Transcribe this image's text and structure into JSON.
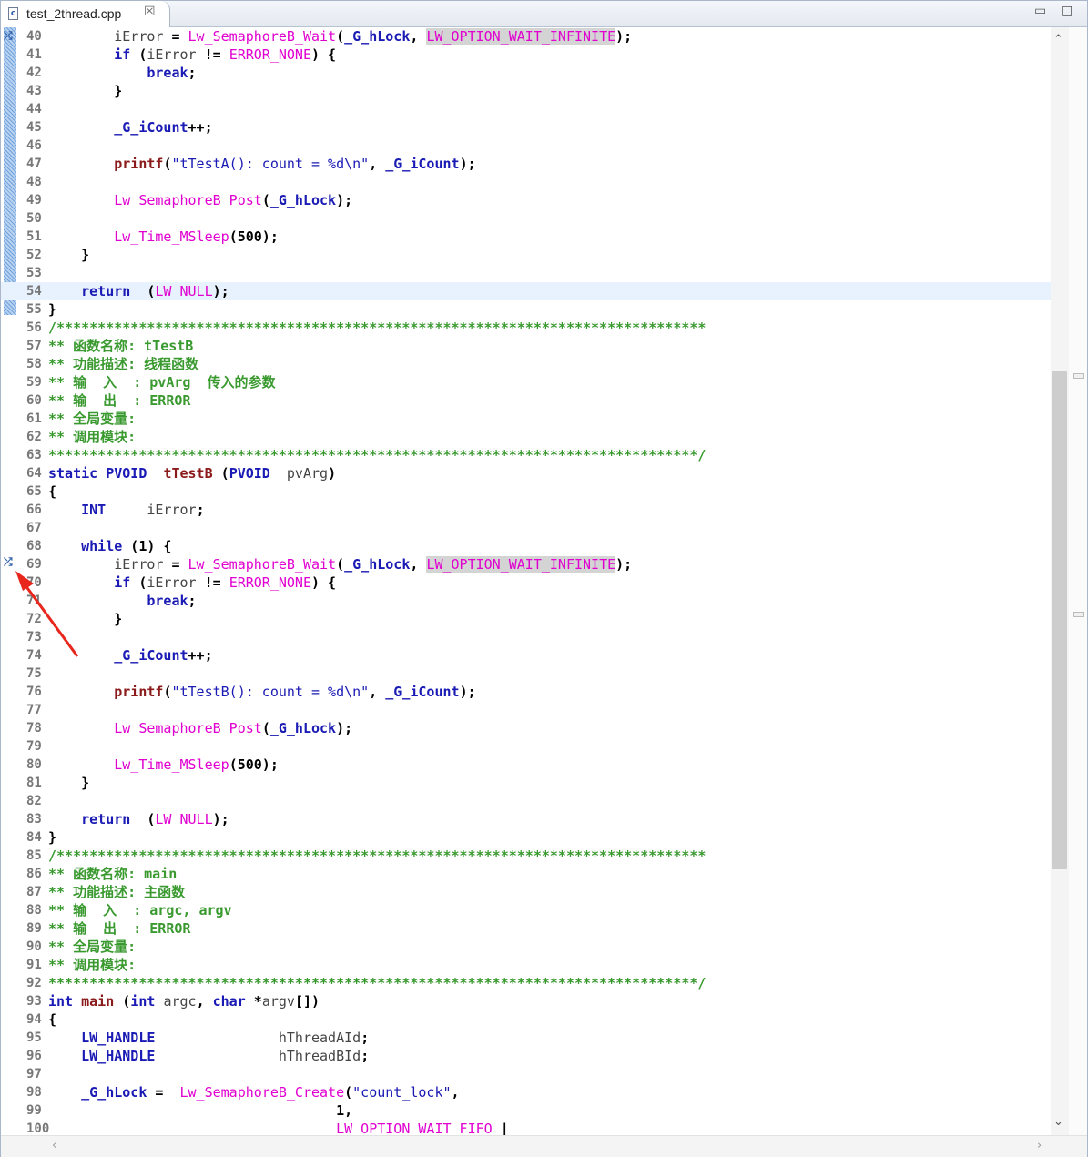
{
  "tab": {
    "file_icon": "c",
    "title": "test_2thread.cpp",
    "close": "☒"
  },
  "window": {
    "minimize": "▭",
    "maximize": "□"
  },
  "scroll": {
    "up": "⌃",
    "down": "⌄",
    "left": "‹",
    "right": "›"
  },
  "lines": [
    {
      "n": "40",
      "c": "        <span class='var'>iError</span> = <span class='fn'>Lw_SemaphoreB_Wait</span>(<span class='gvar'>_G_hLock</span>, <span class='mac hl'>LW_OPTION_WAIT_INFINITE</span>);"
    },
    {
      "n": "41",
      "c": "        <span class='kb'>if</span> (<span class='var'>iError</span> != <span class='mac'>ERROR_NONE</span>) {"
    },
    {
      "n": "42",
      "c": "            <span class='kb'>break</span>;"
    },
    {
      "n": "43",
      "c": "        }"
    },
    {
      "n": "44",
      "c": ""
    },
    {
      "n": "45",
      "c": "        <span class='gvar'>_G_iCount</span>++;"
    },
    {
      "n": "46",
      "c": ""
    },
    {
      "n": "47",
      "c": "        <span class='fnb'>printf</span>(<span class='str'>\"tTestA(): count = %d\\n\"</span>, <span class='gvar'>_G_iCount</span>);"
    },
    {
      "n": "48",
      "c": ""
    },
    {
      "n": "49",
      "c": "        <span class='fn'>Lw_SemaphoreB_Post</span>(<span class='gvar'>_G_hLock</span>);"
    },
    {
      "n": "50",
      "c": ""
    },
    {
      "n": "51",
      "c": "        <span class='fn'>Lw_Time_MSleep</span>(500);"
    },
    {
      "n": "52",
      "c": "    }"
    },
    {
      "n": "53",
      "c": ""
    },
    {
      "n": "54",
      "c": "    <span class='kb'>return</span>  (<span class='mac'>LW_NULL</span>);",
      "current": true
    },
    {
      "n": "55",
      "c": "}"
    },
    {
      "n": "56",
      "c": "<span class='cm'>/*******************************************************************************</span>"
    },
    {
      "n": "57",
      "c": "<span class='cm'>** 函数名称: tTestB</span>"
    },
    {
      "n": "58",
      "c": "<span class='cm'>** 功能描述: 线程函数</span>"
    },
    {
      "n": "59",
      "c": "<span class='cm'>** 输  入  : pvArg  传入的参数</span>"
    },
    {
      "n": "60",
      "c": "<span class='cm'>** 输  出  : ERROR</span>"
    },
    {
      "n": "61",
      "c": "<span class='cm'>** 全局变量:</span>"
    },
    {
      "n": "62",
      "c": "<span class='cm'>** 调用模块:</span>"
    },
    {
      "n": "63",
      "c": "<span class='cm'>*******************************************************************************/</span>"
    },
    {
      "n": "64",
      "c": "<span class='kb'>static</span> <span class='ty'>PVOID</span>  <span class='fnb'>tTestB</span> (<span class='ty'>PVOID</span>  <span class='var'>pvArg</span>)"
    },
    {
      "n": "65",
      "c": "{"
    },
    {
      "n": "66",
      "c": "    <span class='ty'>INT</span>     <span class='var'>iError</span>;"
    },
    {
      "n": "67",
      "c": ""
    },
    {
      "n": "68",
      "c": "    <span class='kb'>while</span> (1) {"
    },
    {
      "n": "69",
      "c": "        <span class='var'>iError</span> = <span class='fn'>Lw_SemaphoreB_Wait</span>(<span class='gvar'>_G_hLock</span>, <span class='mac hl'>LW_OPTION_WAIT_INFINITE</span>);"
    },
    {
      "n": "70",
      "c": "        <span class='kb'>if</span> (<span class='var'>iError</span> != <span class='mac'>ERROR_NONE</span>) {"
    },
    {
      "n": "71",
      "c": "            <span class='kb'>break</span>;"
    },
    {
      "n": "72",
      "c": "        }"
    },
    {
      "n": "73",
      "c": ""
    },
    {
      "n": "74",
      "c": "        <span class='gvar'>_G_iCount</span>++;"
    },
    {
      "n": "75",
      "c": ""
    },
    {
      "n": "76",
      "c": "        <span class='fnb'>printf</span>(<span class='str'>\"tTestB(): count = %d\\n\"</span>, <span class='gvar'>_G_iCount</span>);"
    },
    {
      "n": "77",
      "c": ""
    },
    {
      "n": "78",
      "c": "        <span class='fn'>Lw_SemaphoreB_Post</span>(<span class='gvar'>_G_hLock</span>);"
    },
    {
      "n": "79",
      "c": ""
    },
    {
      "n": "80",
      "c": "        <span class='fn'>Lw_Time_MSleep</span>(500);"
    },
    {
      "n": "81",
      "c": "    }"
    },
    {
      "n": "82",
      "c": ""
    },
    {
      "n": "83",
      "c": "    <span class='kb'>return</span>  (<span class='mac'>LW_NULL</span>);"
    },
    {
      "n": "84",
      "c": "}"
    },
    {
      "n": "85",
      "c": "<span class='cm'>/*******************************************************************************</span>"
    },
    {
      "n": "86",
      "c": "<span class='cm'>** 函数名称: main</span>"
    },
    {
      "n": "87",
      "c": "<span class='cm'>** 功能描述: 主函数</span>"
    },
    {
      "n": "88",
      "c": "<span class='cm'>** 输  入  : argc, argv</span>"
    },
    {
      "n": "89",
      "c": "<span class='cm'>** 输  出  : ERROR</span>"
    },
    {
      "n": "90",
      "c": "<span class='cm'>** 全局变量:</span>"
    },
    {
      "n": "91",
      "c": "<span class='cm'>** 调用模块:</span>"
    },
    {
      "n": "92",
      "c": "<span class='cm'>*******************************************************************************/</span>"
    },
    {
      "n": "93",
      "c": "<span class='kb'>int</span> <span class='fnb'>main</span> (<span class='kb'>int</span> <span class='var'>argc</span>, <span class='kb'>char</span> *<span class='var'>argv</span>[])"
    },
    {
      "n": "94",
      "c": "{"
    },
    {
      "n": "95",
      "c": "    <span class='ty'>LW_HANDLE</span>               <span class='var'>hThreadAId</span>;"
    },
    {
      "n": "96",
      "c": "    <span class='ty'>LW_HANDLE</span>               <span class='var'>hThreadBId</span>;"
    },
    {
      "n": "97",
      "c": ""
    },
    {
      "n": "98",
      "c": "    <span class='gvar'>_G_hLock</span> =  <span class='fn'>Lw_SemaphoreB_Create</span>(<span class='str'>\"count_lock\"</span>,"
    },
    {
      "n": "99",
      "c": "                                   1,"
    },
    {
      "n": "100",
      "c": "                                   <span class='mac'>LW_OPTION_WAIT_FIFO</span> |"
    }
  ]
}
